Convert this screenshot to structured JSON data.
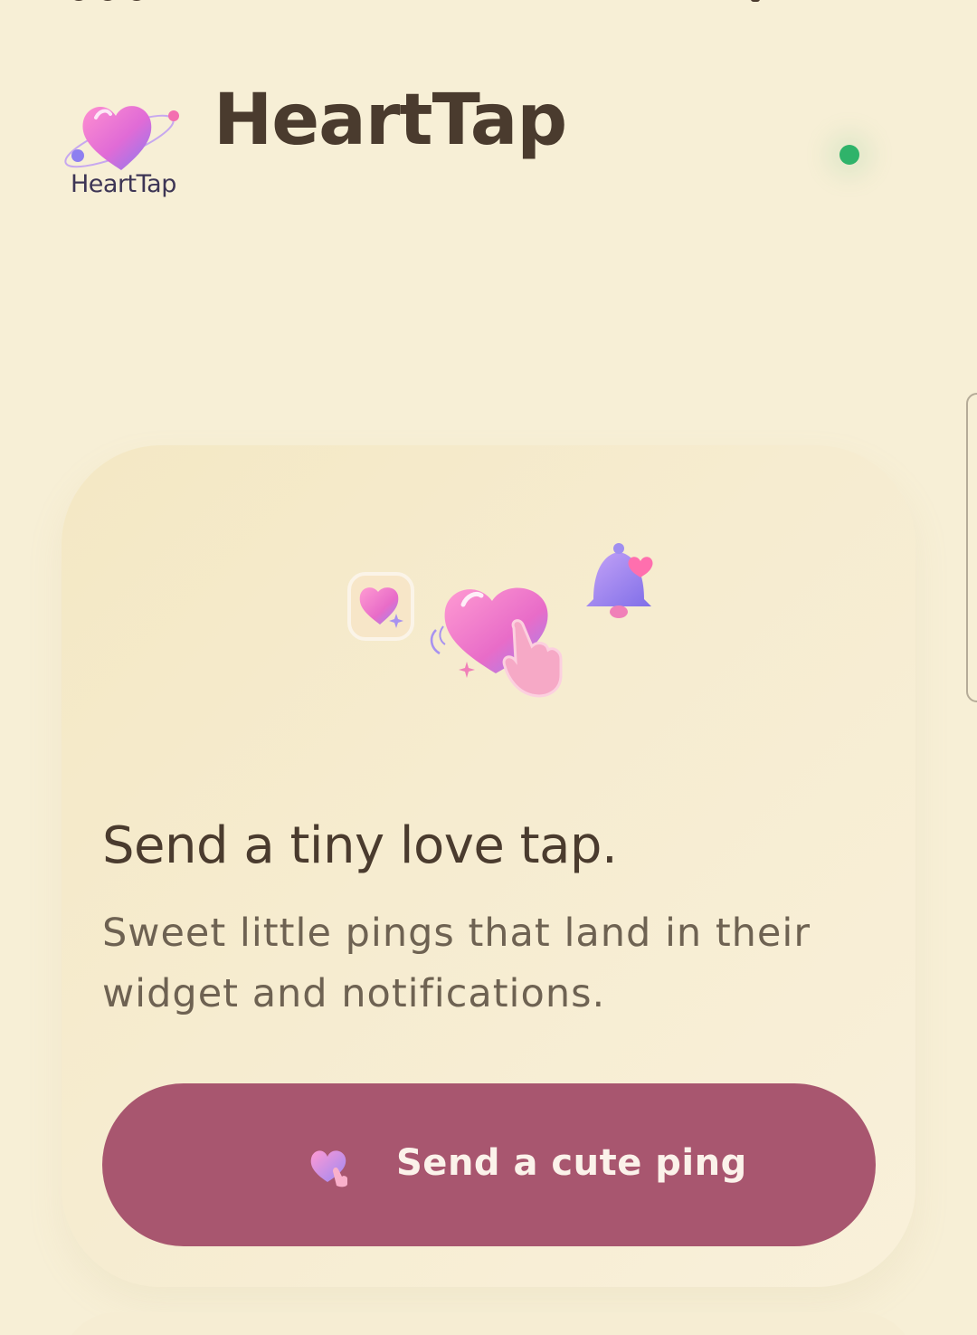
{
  "header": {
    "logo_caption": "HeartTap",
    "title": "HeartTap",
    "status_color": "#2fb36a"
  },
  "hero": {
    "headline": "Send a tiny love tap.",
    "subtext": "Sweet little pings that land in their widget and notifications.",
    "button_label": "Send a cute ping",
    "button_color": "#a8566f",
    "illustration_icons": [
      "heart-widget-icon",
      "heart-tap-icon",
      "notification-bell-icon"
    ]
  }
}
